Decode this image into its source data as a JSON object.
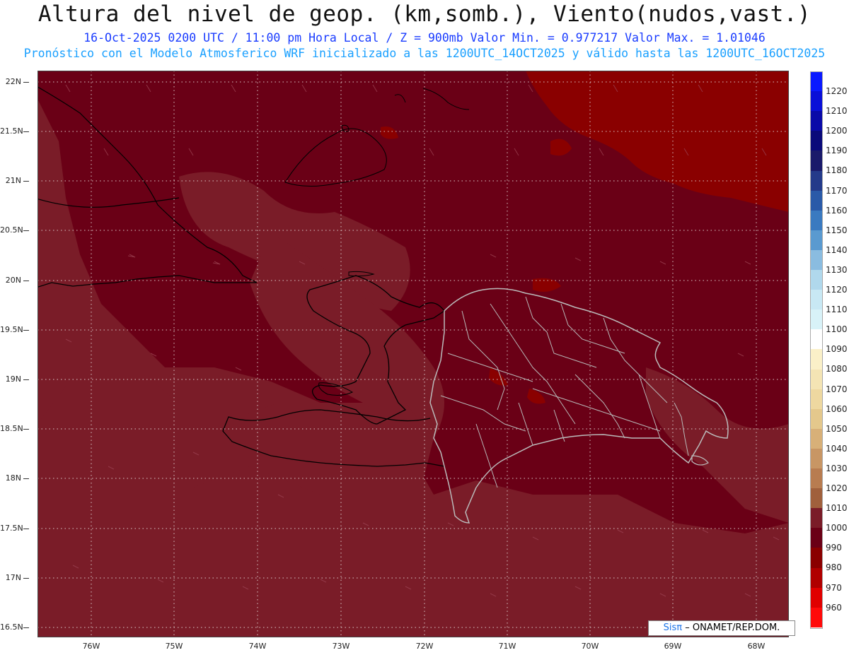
{
  "header": {
    "title": "Altura del nivel de geop. (km,somb.), Viento(nudos,vast.)",
    "line1": "16-Oct-2025  0200 UTC / 11:00 pm Hora Local / Z = 900mb   Valor Min. = 0.977217  Valor Max. = 1.01046",
    "line2": "Pronóstico con el Modelo Atmosferico WRF inicializado a las 1200UTC_14OCT2025 y válido hasta las  1200UTC_16OCT2025"
  },
  "axes": {
    "lat_labels": [
      "22N",
      "21.5N",
      "21N",
      "20.5N",
      "20N",
      "19.5N",
      "19N",
      "18.5N",
      "18N",
      "17.5N",
      "17N",
      "16.5N"
    ],
    "lon_labels": [
      "76W",
      "75W",
      "74W",
      "73W",
      "72W",
      "71W",
      "70W",
      "69W",
      "68W"
    ]
  },
  "colorbar": {
    "labels": [
      "1220",
      "1210",
      "1200",
      "1190",
      "1180",
      "1170",
      "1160",
      "1150",
      "1140",
      "1130",
      "1120",
      "1110",
      "1100",
      "1090",
      "1080",
      "1070",
      "1060",
      "1050",
      "1040",
      "1030",
      "1020",
      "1010",
      "1000",
      "990",
      "980",
      "970",
      "960"
    ],
    "colors": [
      "#0a1aff",
      "#0a10d8",
      "#0a0aa8",
      "#0a0a7a",
      "#1a1a6a",
      "#243a8a",
      "#2a5aa8",
      "#3a7ac0",
      "#5a9ad0",
      "#8abce0",
      "#b0d8ec",
      "#c8e8f4",
      "#d8f2f8",
      "#ffffff",
      "#faf0c8",
      "#f4e4b4",
      "#eed8a0",
      "#e4c88c",
      "#d8b078",
      "#c89664",
      "#b87c50",
      "#a0603c",
      "#7a1c28",
      "#6a0016",
      "#8a0000",
      "#b00000",
      "#e00000"
    ],
    "extra_bottom": "#ff0a0a"
  },
  "field_colors": {
    "c1000": "#7a1c28",
    "c990": "#6a0016",
    "c980": "#8a0000",
    "c970": "#b00000"
  },
  "credit": {
    "logo": "Sisπ",
    "text": "– ONAMET/REP.DOM."
  }
}
